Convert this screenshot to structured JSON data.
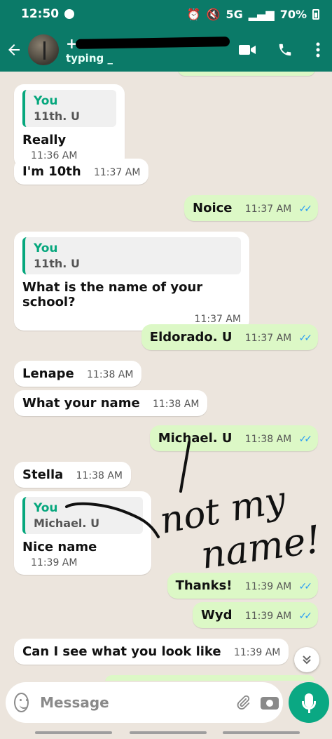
{
  "status_bar": {
    "time": "12:50",
    "network": "5G",
    "battery": "70%"
  },
  "header": {
    "contact_prefix": "+",
    "status": "typing _"
  },
  "messages": [
    {
      "dir": "in",
      "quote_author": "You",
      "quote_text": "11th. U",
      "text": "Really",
      "time": "11:36 AM"
    },
    {
      "dir": "in",
      "text": "I'm 10th",
      "time": "11:37 AM"
    },
    {
      "dir": "out",
      "text": "Noice",
      "time": "11:37 AM"
    },
    {
      "dir": "in",
      "quote_author": "You",
      "quote_text": "11th. U",
      "text": "What is the name of your school?",
      "time": "11:37 AM"
    },
    {
      "dir": "out",
      "text": "Eldorado. U",
      "time": "11:37 AM"
    },
    {
      "dir": "in",
      "text": "Lenape",
      "time": "11:38 AM"
    },
    {
      "dir": "in",
      "text": "What your name",
      "time": "11:38 AM"
    },
    {
      "dir": "out",
      "text": "Michael. U",
      "time": "11:38 AM"
    },
    {
      "dir": "in",
      "text": "Stella",
      "time": "11:38 AM"
    },
    {
      "dir": "in",
      "quote_author": "You",
      "quote_text": "Michael. U",
      "text": "Nice name",
      "time": "11:39 AM"
    },
    {
      "dir": "out",
      "text": "Thanks!",
      "time": "11:39 AM"
    },
    {
      "dir": "out",
      "text": "Wyd",
      "time": "11:39 AM"
    },
    {
      "dir": "in",
      "text": "Can I see what you look like",
      "time": "11:39 AM"
    }
  ],
  "annotation": {
    "line1": "not my",
    "line2": "name!"
  },
  "composer": {
    "placeholder": "Message"
  },
  "icons": {
    "back": "arrow-left-icon",
    "video": "video-call-icon",
    "call": "phone-icon",
    "menu": "more-vert-icon",
    "emoji": "emoji-icon",
    "attach": "paperclip-icon",
    "camera": "camera-icon",
    "mic": "microphone-icon",
    "scroll": "chevron-double-down-icon",
    "read": "double-check-icon"
  },
  "colors": {
    "header": "#0b7a68",
    "outgoing": "#dcf8c6",
    "incoming": "#ffffff",
    "accent": "#06a77d",
    "read_ticks": "#2a9df4",
    "mic": "#0aa883"
  }
}
